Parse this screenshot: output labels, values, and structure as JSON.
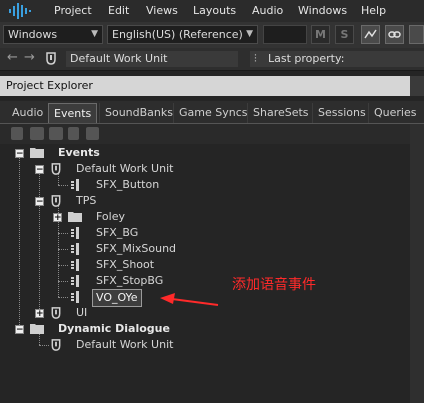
{
  "menubar": {
    "items": [
      "Project",
      "Edit",
      "Views",
      "Layouts",
      "Audio",
      "Windows",
      "Help"
    ]
  },
  "toolbar": {
    "layout_select": "Windows",
    "language_select": "English(US) (Reference)",
    "btn_m": "M",
    "btn_s": "S"
  },
  "navbar": {
    "back_icon": "arrow-left-icon",
    "forward_icon": "arrow-right-icon",
    "work_unit_path": "Default Work Unit",
    "last_property": "Last property:"
  },
  "panel": {
    "title": "Project Explorer"
  },
  "tabs": [
    "Audio",
    "Events",
    "SoundBanks",
    "Game Syncs",
    "ShareSets",
    "Sessions",
    "Queries"
  ],
  "active_tab": "Events",
  "tree": {
    "events": "Events",
    "wu1": "Default Work Unit",
    "sfx_button": "SFX_Button",
    "tps": "TPS",
    "foley": "Foley",
    "sfx_bg": "SFX_BG",
    "sfx_mixsound": "SFX_MixSound",
    "sfx_shoot": "SFX_Shoot",
    "sfx_stopbg": "SFX_StopBG",
    "vo_oye": "VO_OYe",
    "ui": "UI",
    "dynamic_dialogue": "Dynamic Dialogue",
    "wu2": "Default Work Unit"
  },
  "annotation": {
    "text": "添加语音事件",
    "color": "#ff2a2a"
  }
}
